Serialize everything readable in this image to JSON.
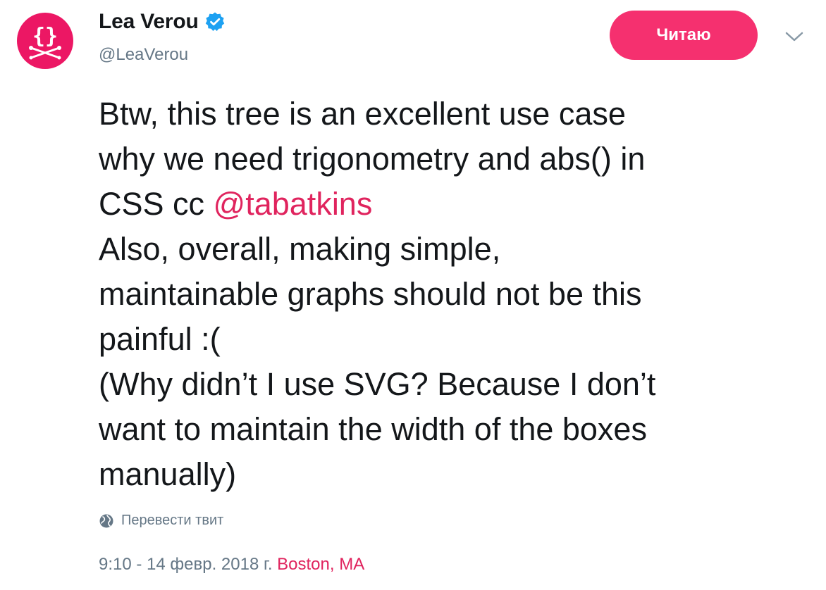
{
  "author": {
    "display_name": "Lea Verou",
    "handle": "@LeaVerou",
    "verified": true,
    "avatar_color": "#ec1764",
    "avatar_icon": "braces-crossed-swords-logo"
  },
  "follow_button": {
    "label": "Читаю",
    "color": "#f5306f"
  },
  "menu": {
    "icon": "chevron-down-icon"
  },
  "tweet": {
    "line_1": "Btw, this tree is an excellent use case",
    "line_2": "why we need trigonometry and abs() in",
    "line_3_prefix": "CSS cc ",
    "mention": "@tabatkins",
    "line_4": "Also, overall, making simple,",
    "line_5": "maintainable graphs should not be this",
    "line_6": "painful :(",
    "line_7": "(Why didn’t I use SVG? Because I don’t",
    "line_8": "want to maintain the width of the boxes",
    "line_9": "manually)"
  },
  "translate": {
    "label": "Перевести твит",
    "icon": "globe-icon"
  },
  "meta": {
    "timestamp": "9:10 - 14 февр. 2018 г.",
    "location": "Boston, MA"
  },
  "colors": {
    "accent": "#e0245e",
    "secondary_text": "#657786",
    "verified_badge": "#1da1f2"
  }
}
